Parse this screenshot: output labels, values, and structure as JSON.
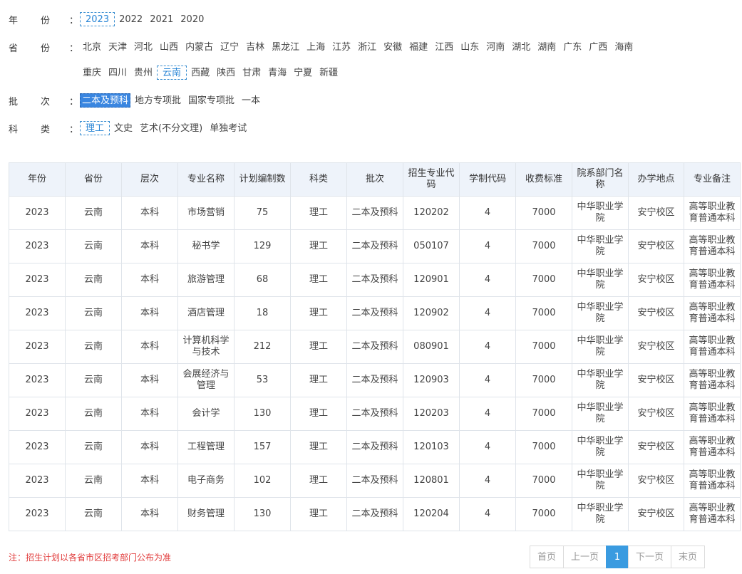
{
  "filters": {
    "year": {
      "label_a": "年",
      "label_b": "份",
      "colon": "：",
      "options": [
        "2023",
        "2022",
        "2021",
        "2020"
      ],
      "selected_index": 0
    },
    "province": {
      "label_a": "省",
      "label_b": "份",
      "colon": "：",
      "row1": [
        "北京",
        "天津",
        "河北",
        "山西",
        "内蒙古",
        "辽宁",
        "吉林",
        "黑龙江",
        "上海",
        "江苏",
        "浙江",
        "安徽",
        "福建",
        "江西",
        "山东",
        "河南",
        "湖北",
        "湖南",
        "广东",
        "广西",
        "海南"
      ],
      "row2": [
        "重庆",
        "四川",
        "贵州",
        "云南",
        "西藏",
        "陕西",
        "甘肃",
        "青海",
        "宁夏",
        "新疆"
      ],
      "selected": "云南"
    },
    "batch": {
      "label_a": "批",
      "label_b": "次",
      "colon": "：",
      "options": [
        "二本及预科",
        "地方专项批",
        "国家专项批",
        "一本"
      ],
      "selected_index": 0
    },
    "category": {
      "label_a": "科",
      "label_b": "类",
      "colon": "：",
      "options": [
        "理工",
        "文史",
        "艺术(不分文理)",
        "单独考试"
      ],
      "selected_index": 0
    }
  },
  "table": {
    "headers": [
      "年份",
      "省份",
      "层次",
      "专业名称",
      "计划编制数",
      "科类",
      "批次",
      "招生专业代码",
      "学制代码",
      "收费标准",
      "院系部门名称",
      "办学地点",
      "专业备注"
    ],
    "rows": [
      [
        "2023",
        "云南",
        "本科",
        "市场营销",
        "75",
        "理工",
        "二本及预科",
        "120202",
        "4",
        "7000",
        "中华职业学院",
        "安宁校区",
        "高等职业教育普通本科"
      ],
      [
        "2023",
        "云南",
        "本科",
        "秘书学",
        "129",
        "理工",
        "二本及预科",
        "050107",
        "4",
        "7000",
        "中华职业学院",
        "安宁校区",
        "高等职业教育普通本科"
      ],
      [
        "2023",
        "云南",
        "本科",
        "旅游管理",
        "68",
        "理工",
        "二本及预科",
        "120901",
        "4",
        "7000",
        "中华职业学院",
        "安宁校区",
        "高等职业教育普通本科"
      ],
      [
        "2023",
        "云南",
        "本科",
        "酒店管理",
        "18",
        "理工",
        "二本及预科",
        "120902",
        "4",
        "7000",
        "中华职业学院",
        "安宁校区",
        "高等职业教育普通本科"
      ],
      [
        "2023",
        "云南",
        "本科",
        "计算机科学与技术",
        "212",
        "理工",
        "二本及预科",
        "080901",
        "4",
        "7000",
        "中华职业学院",
        "安宁校区",
        "高等职业教育普通本科"
      ],
      [
        "2023",
        "云南",
        "本科",
        "会展经济与管理",
        "53",
        "理工",
        "二本及预科",
        "120903",
        "4",
        "7000",
        "中华职业学院",
        "安宁校区",
        "高等职业教育普通本科"
      ],
      [
        "2023",
        "云南",
        "本科",
        "会计学",
        "130",
        "理工",
        "二本及预科",
        "120203",
        "4",
        "7000",
        "中华职业学院",
        "安宁校区",
        "高等职业教育普通本科"
      ],
      [
        "2023",
        "云南",
        "本科",
        "工程管理",
        "157",
        "理工",
        "二本及预科",
        "120103",
        "4",
        "7000",
        "中华职业学院",
        "安宁校区",
        "高等职业教育普通本科"
      ],
      [
        "2023",
        "云南",
        "本科",
        "电子商务",
        "102",
        "理工",
        "二本及预科",
        "120801",
        "4",
        "7000",
        "中华职业学院",
        "安宁校区",
        "高等职业教育普通本科"
      ],
      [
        "2023",
        "云南",
        "本科",
        "财务管理",
        "130",
        "理工",
        "二本及预科",
        "120204",
        "4",
        "7000",
        "中华职业学院",
        "安宁校区",
        "高等职业教育普通本科"
      ]
    ]
  },
  "note": "注：招生计划以各省市区招考部门公布为准",
  "pager": {
    "first": "首页",
    "prev": "上一页",
    "current": "1",
    "next": "下一页",
    "last": "末页"
  },
  "colors": {
    "accent": "#3a9be0",
    "selected_border": "#3b8fd1",
    "note": "#e13b3b",
    "header_bg": "#eef3fa"
  }
}
